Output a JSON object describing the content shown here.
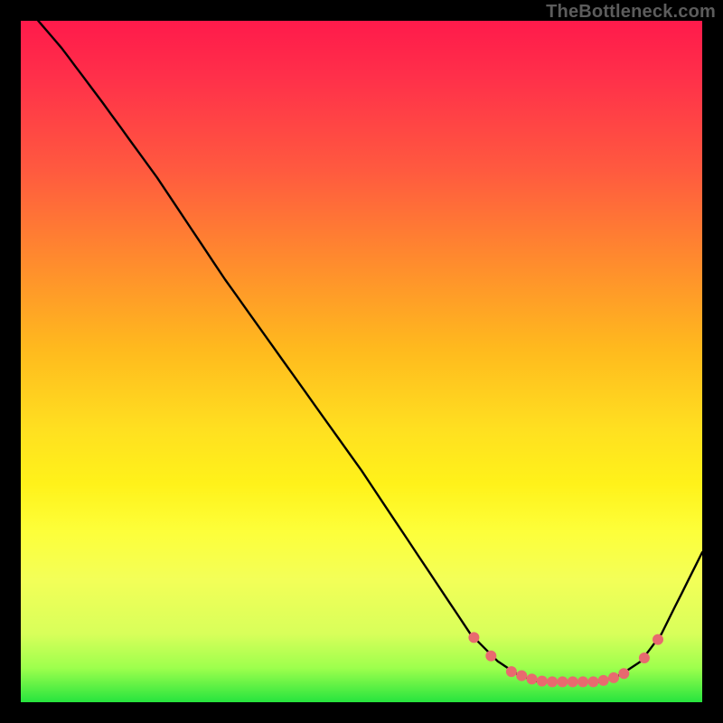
{
  "watermark": "TheBottleneck.com",
  "chart_data": {
    "type": "line",
    "title": "",
    "xlabel": "",
    "ylabel": "",
    "xlim": [
      0,
      100
    ],
    "ylim": [
      0,
      100
    ],
    "series": [
      {
        "name": "curve",
        "x": [
          0,
          6,
          12,
          20,
          30,
          40,
          50,
          60,
          66,
          70,
          73,
          76,
          79,
          82,
          85,
          88,
          91,
          94,
          100
        ],
        "y": [
          103,
          96,
          88,
          77,
          62,
          48,
          34,
          19,
          10,
          6,
          4,
          3,
          3,
          3,
          3,
          4,
          6,
          10,
          22
        ]
      }
    ],
    "markers": {
      "name": "dots",
      "x": [
        66.5,
        69,
        72,
        73.5,
        75,
        76.5,
        78,
        79.5,
        81,
        82.5,
        84,
        85.5,
        87,
        88.5,
        91.5,
        93.5
      ],
      "y": [
        9.5,
        6.8,
        4.5,
        3.9,
        3.4,
        3.1,
        3.0,
        3.0,
        3.0,
        3.0,
        3.0,
        3.2,
        3.6,
        4.2,
        6.5,
        9.2
      ]
    },
    "colors": {
      "curve": "#000000",
      "markers": "#e86a6f"
    }
  }
}
